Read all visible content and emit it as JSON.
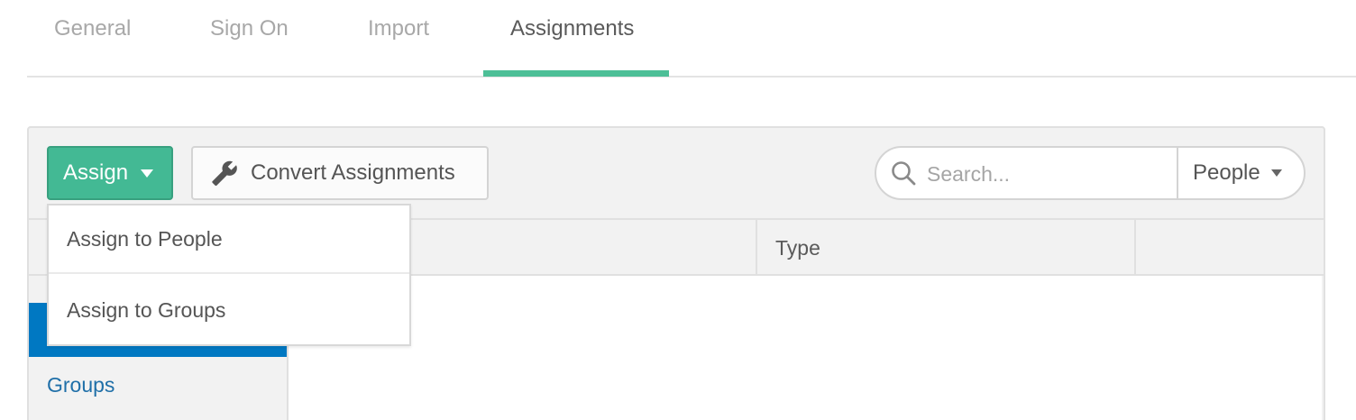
{
  "tabs": [
    {
      "label": "General",
      "active": false
    },
    {
      "label": "Sign On",
      "active": false
    },
    {
      "label": "Import",
      "active": false
    },
    {
      "label": "Assignments",
      "active": true
    }
  ],
  "toolbar": {
    "assign_label": "Assign",
    "convert_label": "Convert Assignments",
    "convert_icon": "wrench-icon",
    "search_icon": "search-icon",
    "search_placeholder": "Search...",
    "search_scope": "People"
  },
  "assign_menu": {
    "items": [
      {
        "label": "Assign to People"
      },
      {
        "label": "Assign to Groups"
      }
    ]
  },
  "table": {
    "columns": [
      "",
      "Type",
      ""
    ]
  },
  "sidebar": {
    "items": [
      {
        "label": "",
        "active": true
      },
      {
        "label": "Groups",
        "active": false
      }
    ]
  },
  "colors": {
    "accent": "#43b994",
    "tab_underline": "#4dbf97",
    "active_sidebar": "#0078c2",
    "link": "#1f6fa8"
  }
}
